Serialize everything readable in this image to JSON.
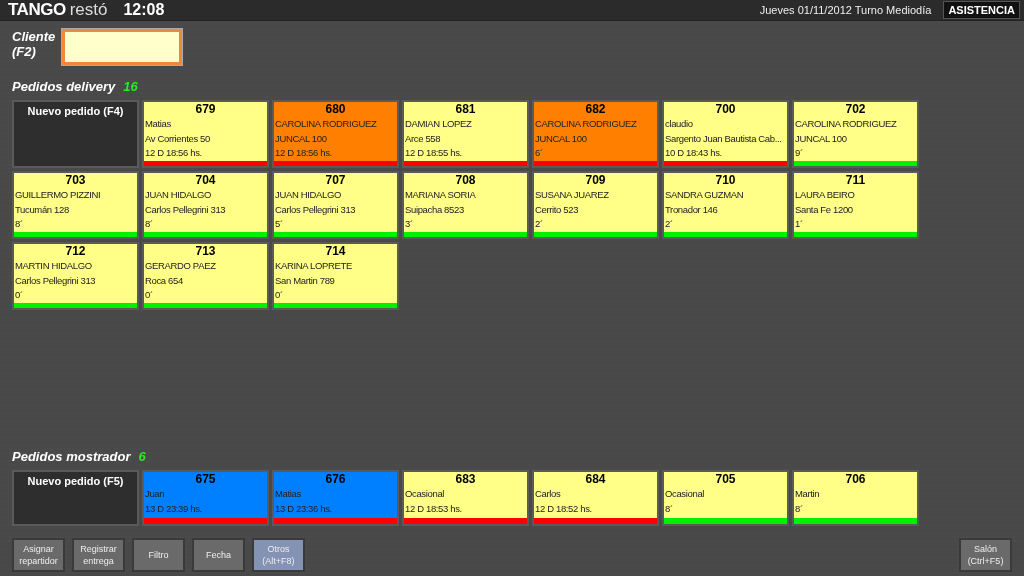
{
  "header": {
    "brand": "TANGO",
    "product": "restó",
    "time": "12:08",
    "date_shift": "Jueves 01/11/2012 Turno Mediodía",
    "attendance_button": "ASISTENCIA"
  },
  "client": {
    "label": "Cliente (F2)"
  },
  "delivery": {
    "title": "Pedidos delivery",
    "count": "16",
    "new_order": "Nuevo pedido (F4)",
    "orders": [
      {
        "number": "679",
        "lines": [
          "Matias",
          "Av Corrientes 50",
          "12 D  18:56 hs."
        ],
        "color": "#ffff88",
        "late": true
      },
      {
        "number": "680",
        "lines": [
          "CAROLINA RODRIGUEZ",
          "JUNCAL 100",
          "12 D  18:56 hs."
        ],
        "color": "#ff8000",
        "late": true
      },
      {
        "number": "681",
        "lines": [
          "DAMIAN LOPEZ",
          "Arce 558",
          "12 D  18:55 hs."
        ],
        "color": "#ffff88",
        "late": true
      },
      {
        "number": "682",
        "lines": [
          "CAROLINA RODRIGUEZ",
          "JUNCAL 100",
          "6´"
        ],
        "color": "#ff8000",
        "late": true
      },
      {
        "number": "700",
        "lines": [
          "claudio",
          "Sargento Juan Bautista Cab...",
          "10 D  18:43 hs."
        ],
        "color": "#ffff88",
        "late": true
      },
      {
        "number": "702",
        "lines": [
          "CAROLINA RODRIGUEZ",
          "JUNCAL 100",
          "9´"
        ],
        "color": "#ffff88",
        "late": false
      },
      {
        "number": "703",
        "lines": [
          "GUILLERMO PIZZINI",
          "Tucumán 128",
          "8´"
        ],
        "color": "#ffff88",
        "late": false
      },
      {
        "number": "704",
        "lines": [
          "JUAN HIDALGO",
          "Carlos Pellegrini 313",
          "8´"
        ],
        "color": "#ffff88",
        "late": false
      },
      {
        "number": "707",
        "lines": [
          "JUAN HIDALGO",
          "Carlos Pellegrini 313",
          "5´"
        ],
        "color": "#ffff88",
        "late": false
      },
      {
        "number": "708",
        "lines": [
          "MARIANA SORIA",
          "Suipacha 8523",
          "3´"
        ],
        "color": "#ffff88",
        "late": false
      },
      {
        "number": "709",
        "lines": [
          "SUSANA JUAREZ",
          "Cerrito 523",
          "2´"
        ],
        "color": "#ffff88",
        "late": false
      },
      {
        "number": "710",
        "lines": [
          "SANDRA GUZMAN",
          "Tronador 146",
          "2´"
        ],
        "color": "#ffff88",
        "late": false
      },
      {
        "number": "711",
        "lines": [
          "LAURA BEIRO",
          "Santa Fe 1200",
          "1´"
        ],
        "color": "#ffff88",
        "late": false
      },
      {
        "number": "712",
        "lines": [
          "MARTIN HIDALGO",
          "Carlos Pellegrini 313",
          "0´"
        ],
        "color": "#ffff88",
        "late": false
      },
      {
        "number": "713",
        "lines": [
          "GERARDO PAEZ",
          "Roca 654",
          "0´"
        ],
        "color": "#ffff88",
        "late": false
      },
      {
        "number": "714",
        "lines": [
          "KARINA LOPRETE",
          "San Martin 789",
          "0´"
        ],
        "color": "#ffff88",
        "late": false
      }
    ]
  },
  "counter": {
    "title": "Pedidos mostrador",
    "count": "6",
    "new_order": "Nuevo pedido (F5)",
    "orders": [
      {
        "number": "675",
        "lines": [
          "Juan",
          "13 D  23:39 hs."
        ],
        "color": "#0080ff",
        "late": true
      },
      {
        "number": "676",
        "lines": [
          "Matias",
          "13 D  23:36 hs."
        ],
        "color": "#0080ff",
        "late": true
      },
      {
        "number": "683",
        "lines": [
          "Ocasional",
          "12 D  18:53 hs."
        ],
        "color": "#ffff88",
        "late": true
      },
      {
        "number": "684",
        "lines": [
          "Carlos",
          "12 D  18:52 hs."
        ],
        "color": "#ffff88",
        "late": true
      },
      {
        "number": "705",
        "lines": [
          "Ocasional",
          "8´"
        ],
        "color": "#ffff88",
        "late": false
      },
      {
        "number": "706",
        "lines": [
          "Martin",
          "8´"
        ],
        "color": "#ffff88",
        "late": false
      }
    ]
  },
  "toolbar": [
    {
      "label": "Asignar repartidor",
      "active": false
    },
    {
      "label": "Registrar entrega",
      "active": false
    },
    {
      "label": "Filtro",
      "active": false
    },
    {
      "label": "Fecha",
      "active": false
    },
    {
      "label": "Otros (Alt+F8)",
      "active": true
    }
  ],
  "salon_button": {
    "label": "Salón (Ctrl+F5)"
  }
}
